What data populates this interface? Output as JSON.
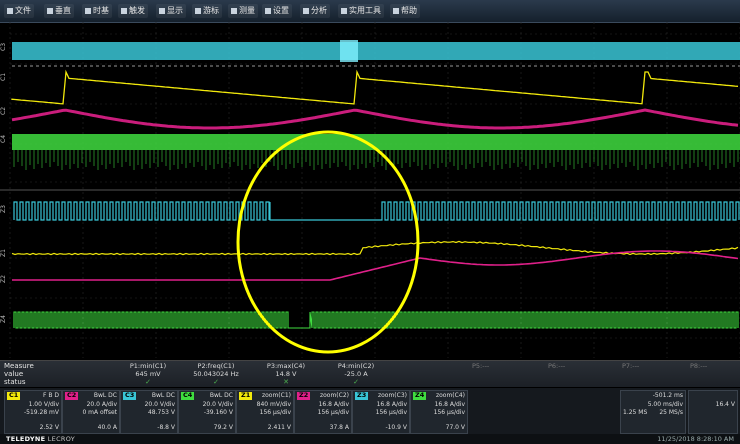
{
  "menu": [
    {
      "label": "文件",
      "icon": "file-icon"
    },
    {
      "label": "垂直",
      "icon": "vertical-icon"
    },
    {
      "label": "时基",
      "icon": "timebase-icon"
    },
    {
      "label": "触发",
      "icon": "trigger-icon"
    },
    {
      "label": "显示",
      "icon": "display-icon"
    },
    {
      "label": "游标",
      "icon": "cursor-icon"
    },
    {
      "label": "测量",
      "icon": "measure-icon"
    },
    {
      "label": "设置",
      "icon": "setup-icon"
    },
    {
      "label": "分析",
      "icon": "analysis-icon"
    },
    {
      "label": "实用工具",
      "icon": "utilities-icon"
    },
    {
      "label": "帮助",
      "icon": "help-icon"
    }
  ],
  "colors": {
    "c1": "#f2e90c",
    "c2": "#e0208a",
    "c3": "#39c5d6",
    "c4": "#3fdc3f",
    "highlight": "#ffff00"
  },
  "trace_labels": [
    "C3",
    "C1",
    "C2",
    "C4",
    "Z3",
    "Z1",
    "Z2",
    "Z4"
  ],
  "measure": {
    "labels": [
      "Measure",
      "value",
      "status"
    ],
    "params": [
      {
        "name": "P1:min(C1)",
        "value": "645 mV",
        "status": "✓"
      },
      {
        "name": "P2:freq(C1)",
        "value": "50.043024 Hz",
        "status": "✓"
      },
      {
        "name": "P3:max(C4)",
        "value": "14.8 V",
        "status": "✕"
      },
      {
        "name": "P4:min(C2)",
        "value": "-25.0 A",
        "status": "✓"
      }
    ],
    "empty": [
      "P5:---",
      "P6:---",
      "P7:---",
      "P8:---"
    ]
  },
  "channels": [
    {
      "tag": "C1",
      "color": "#f2e90c",
      "coupling": "F B D",
      "scale": "1.00 V/div",
      "offset": "-519.28 mV",
      "bottom": "2.52 V"
    },
    {
      "tag": "C2",
      "color": "#e0208a",
      "coupling": "BwL DC",
      "scale": "20.0 A/div",
      "offset": "0 mA offset",
      "bottom": "40.0 A"
    },
    {
      "tag": "C3",
      "color": "#39c5d6",
      "coupling": "BwL DC",
      "scale": "20.0 V/div",
      "offset": "48.753 V",
      "bottom": "-8.8 V"
    },
    {
      "tag": "C4",
      "color": "#3fdc3f",
      "coupling": "BwL DC",
      "scale": "20.0 V/div",
      "offset": "-39.160 V",
      "bottom": "79.2 V"
    },
    {
      "tag": "Z1",
      "color": "#f2e90c",
      "coupling": "zoom(C1)",
      "scale": "840 mV/div",
      "offset": "156 µs/div",
      "bottom": "2.411 V"
    },
    {
      "tag": "Z2",
      "color": "#e0208a",
      "coupling": "zoom(C2)",
      "scale": "16.8 A/div",
      "offset": "156 µs/div",
      "bottom": "37.8 A"
    },
    {
      "tag": "Z3",
      "color": "#39c5d6",
      "coupling": "zoom(C3)",
      "scale": "16.8 A/div",
      "offset": "156 µs/div",
      "bottom": "-10.9 V"
    },
    {
      "tag": "Z4",
      "color": "#3fdc3f",
      "coupling": "zoom(C4)",
      "scale": "16.8 A/div",
      "offset": "156 µs/div",
      "bottom": "77.0 V"
    }
  ],
  "timebase": {
    "delay": "-501.2 ms",
    "div": "5.00 ms/div",
    "samples": "1.25 MS",
    "rate": "25 MS/s"
  },
  "trigger": {
    "level": "16.4 V"
  },
  "footer": {
    "brand_a": "TELEDYNE",
    "brand_b": "LECROY",
    "timestamp": "11/25/2018 8:28:10 AM"
  }
}
